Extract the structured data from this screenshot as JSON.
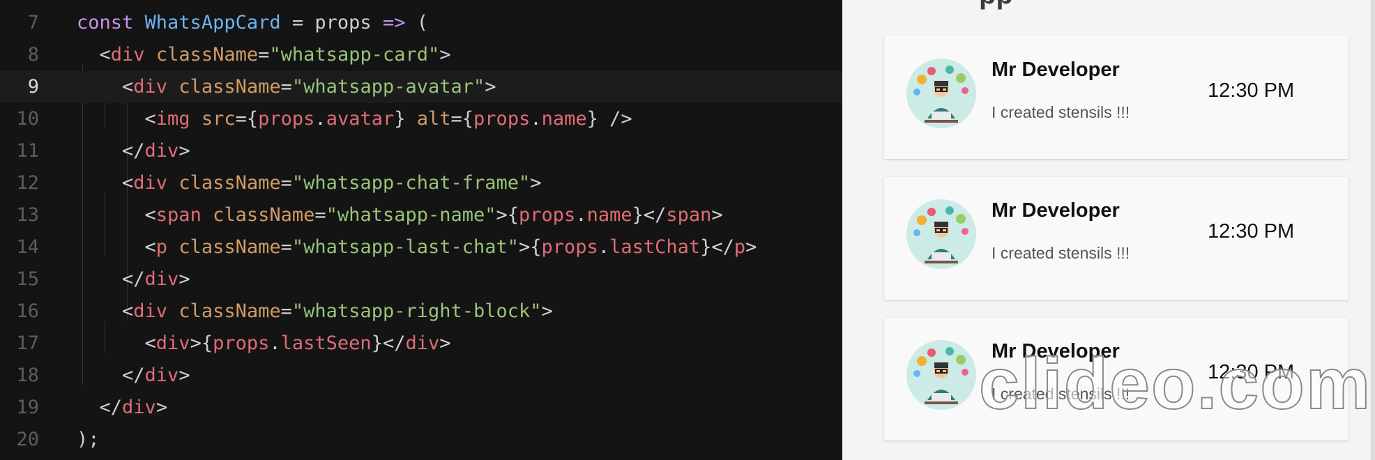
{
  "editor": {
    "active_line": "9",
    "lines": [
      {
        "no": "7",
        "tokens": [
          [
            "kw",
            "const "
          ],
          [
            "fn",
            "WhatsAppCard"
          ],
          [
            "pl",
            " = props "
          ],
          [
            "op",
            "=>"
          ],
          [
            "pl",
            " ("
          ]
        ]
      },
      {
        "no": "8",
        "tokens": [
          [
            "pl",
            "  <"
          ],
          [
            "tag",
            "div"
          ],
          [
            "pl",
            " "
          ],
          [
            "attr",
            "className"
          ],
          [
            "pl",
            "="
          ],
          [
            "str",
            "\"whatsapp-card\""
          ],
          [
            "pl",
            ">"
          ]
        ]
      },
      {
        "no": "9",
        "tokens": [
          [
            "pl",
            "    <"
          ],
          [
            "tag",
            "div"
          ],
          [
            "pl",
            " "
          ],
          [
            "attr",
            "className"
          ],
          [
            "pl",
            "="
          ],
          [
            "str",
            "\"whatsapp-avatar\""
          ],
          [
            "pl",
            ">"
          ]
        ]
      },
      {
        "no": "10",
        "tokens": [
          [
            "pl",
            "      <"
          ],
          [
            "tag",
            "img"
          ],
          [
            "pl",
            " "
          ],
          [
            "attr",
            "src"
          ],
          [
            "pl",
            "={"
          ],
          [
            "pr",
            "props"
          ],
          [
            "pl",
            "."
          ],
          [
            "pr",
            "avatar"
          ],
          [
            "pl",
            "} "
          ],
          [
            "attr",
            "alt"
          ],
          [
            "pl",
            "={"
          ],
          [
            "pr",
            "props"
          ],
          [
            "pl",
            "."
          ],
          [
            "pr",
            "name"
          ],
          [
            "pl",
            "} />"
          ]
        ]
      },
      {
        "no": "11",
        "tokens": [
          [
            "pl",
            "    </"
          ],
          [
            "tag",
            "div"
          ],
          [
            "pl",
            ">"
          ]
        ]
      },
      {
        "no": "12",
        "tokens": [
          [
            "pl",
            "    <"
          ],
          [
            "tag",
            "div"
          ],
          [
            "pl",
            " "
          ],
          [
            "attr",
            "className"
          ],
          [
            "pl",
            "="
          ],
          [
            "str",
            "\"whatsapp-chat-frame\""
          ],
          [
            "pl",
            ">"
          ]
        ]
      },
      {
        "no": "13",
        "tokens": [
          [
            "pl",
            "      <"
          ],
          [
            "tag",
            "span"
          ],
          [
            "pl",
            " "
          ],
          [
            "attr",
            "className"
          ],
          [
            "pl",
            "="
          ],
          [
            "str",
            "\"whatsapp-name\""
          ],
          [
            "pl",
            ">{"
          ],
          [
            "pr",
            "props"
          ],
          [
            "pl",
            "."
          ],
          [
            "pr",
            "name"
          ],
          [
            "pl",
            "}</"
          ],
          [
            "tag",
            "span"
          ],
          [
            "pl",
            ">"
          ]
        ]
      },
      {
        "no": "14",
        "tokens": [
          [
            "pl",
            "      <"
          ],
          [
            "tag",
            "p"
          ],
          [
            "pl",
            " "
          ],
          [
            "attr",
            "className"
          ],
          [
            "pl",
            "="
          ],
          [
            "str",
            "\"whatsapp-last-chat\""
          ],
          [
            "pl",
            ">{"
          ],
          [
            "pr",
            "props"
          ],
          [
            "pl",
            "."
          ],
          [
            "pr",
            "lastChat"
          ],
          [
            "pl",
            "}</"
          ],
          [
            "tag",
            "p"
          ],
          [
            "pl",
            ">"
          ]
        ]
      },
      {
        "no": "15",
        "tokens": [
          [
            "pl",
            "    </"
          ],
          [
            "tag",
            "div"
          ],
          [
            "pl",
            ">"
          ]
        ]
      },
      {
        "no": "16",
        "tokens": [
          [
            "pl",
            "    <"
          ],
          [
            "tag",
            "div"
          ],
          [
            "pl",
            " "
          ],
          [
            "attr",
            "className"
          ],
          [
            "pl",
            "="
          ],
          [
            "str",
            "\"whatsapp-right-block\""
          ],
          [
            "pl",
            ">"
          ]
        ]
      },
      {
        "no": "17",
        "tokens": [
          [
            "pl",
            "      <"
          ],
          [
            "tag",
            "div"
          ],
          [
            "pl",
            ">{"
          ],
          [
            "pr",
            "props"
          ],
          [
            "pl",
            "."
          ],
          [
            "pr",
            "lastSeen"
          ],
          [
            "pl",
            "}</"
          ],
          [
            "tag",
            "div"
          ],
          [
            "pl",
            ">"
          ]
        ]
      },
      {
        "no": "18",
        "tokens": [
          [
            "pl",
            "    </"
          ],
          [
            "tag",
            "div"
          ],
          [
            "pl",
            ">"
          ]
        ]
      },
      {
        "no": "19",
        "tokens": [
          [
            "pl",
            "  </"
          ],
          [
            "tag",
            "div"
          ],
          [
            "pl",
            ">"
          ]
        ]
      },
      {
        "no": "20",
        "tokens": [
          [
            "pl",
            ");"
          ]
        ]
      }
    ]
  },
  "preview": {
    "heading_fragment": "pp",
    "cards": [
      {
        "name": "Mr Developer",
        "last_chat": "I created stensils !!!",
        "time": "12:30 PM"
      },
      {
        "name": "Mr Developer",
        "last_chat": "I created stensils !!!",
        "time": "12:30 PM"
      },
      {
        "name": "Mr Developer",
        "last_chat": "I created stensils !!!",
        "time": "12:30 PM"
      }
    ],
    "watermark": "clideo.com"
  },
  "colors": {
    "editor_bg": "#141414",
    "keyword": "#c792ea",
    "function": "#6fb3f2",
    "tag": "#e06c75",
    "attribute": "#d19a66",
    "string": "#98c379",
    "preview_bg": "#f4f4f4"
  },
  "icons": {
    "avatar": "developer-illustration-icon"
  }
}
